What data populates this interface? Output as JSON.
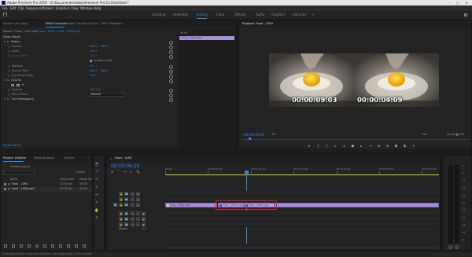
{
  "window": {
    "title": "Adobe Premiere Pro 2019 - D:\\Documents\\Adobe\\Premiere Pro\\13.0\\Untitled *",
    "controls": [
      "–",
      "□",
      "✕"
    ]
  },
  "menu": [
    "File",
    "Edit",
    "Clip",
    "Sequence",
    "Markers",
    "Graphics",
    "View",
    "Window",
    "Help"
  ],
  "workspaces": [
    "Learning",
    "Assembly",
    "Editing",
    "Color",
    "Effects",
    "Audio",
    "Graphics",
    "Libraries",
    "»"
  ],
  "active_workspace": "Editing",
  "source_panel": {
    "tabs": [
      "Source: (no clips)",
      "Effect Controls",
      "Audio Clip Mixer: Food - 1094",
      "Metadata"
    ],
    "active_tab": "Effect Controls",
    "breadcrumb": "Master * Food - 1094.mp4",
    "breadcrumb_sequence": "Food - 1094 * Food - 1094.mp4",
    "section_video": "Video Effects",
    "mini_clip": "Food - 1094.mp4",
    "mini_time": "00:00",
    "rows": [
      {
        "name": "Motion",
        "level": 1,
        "fx": true
      },
      {
        "name": "Position",
        "level": 2,
        "values": [
          "640.0",
          "360.0"
        ]
      },
      {
        "name": "Scale",
        "level": 2,
        "values": [
          "100.0"
        ]
      },
      {
        "name": "Scale Width",
        "level": 2,
        "values": [
          "100.0"
        ],
        "dim": true
      },
      {
        "name": "",
        "level": 2,
        "checkbox": "Uniform Scale"
      },
      {
        "name": "Rotation",
        "level": 2,
        "values": [
          "0.0"
        ]
      },
      {
        "name": "Anchor Point",
        "level": 2,
        "values": [
          "640.0",
          "360.0"
        ]
      },
      {
        "name": "Anti-flicker Filter",
        "level": 2,
        "values": [
          "0.00"
        ]
      },
      {
        "name": "Opacity",
        "level": 1,
        "fx": true
      },
      {
        "name": "",
        "level": 2,
        "shapes": true
      },
      {
        "name": "Opacity",
        "level": 2,
        "values": [
          "100.0 %"
        ]
      },
      {
        "name": "Blend Mode",
        "level": 2,
        "select": "Normal"
      },
      {
        "name": "Time Remapping",
        "level": 1,
        "fx": true
      }
    ],
    "timecode": "00:00:06:20"
  },
  "program_panel": {
    "title": "Program: Food - 1094",
    "timecode": "+00:00:02:09",
    "fit": "Fit",
    "quality": "Full",
    "duration": "00:00:10:00",
    "frames": [
      {
        "timecode": "00:00:09:03"
      },
      {
        "timecode": "00:00:04:09"
      }
    ],
    "transport_icons": [
      "marker",
      "in",
      "out",
      "go-in",
      "step-back",
      "play",
      "step-forward",
      "go-out",
      "insert",
      "overwrite",
      "export-frame",
      "compare",
      "add"
    ]
  },
  "project_panel": {
    "tabs": [
      "Project: Untitled",
      "Media Browser",
      "Effects",
      "»"
    ],
    "active_tab": "Project: Untitled",
    "file": "Untitled.prproj",
    "item_count": "2 Items",
    "columns": [
      "Name",
      "Frame Rate",
      "Media Sta"
    ],
    "items": [
      {
        "name": "Food - 1094",
        "rate": "25.00 fps",
        "start": "00:00",
        "color": "#46a04a"
      },
      {
        "name": "Food - 1094.mp4",
        "rate": "25.00 fps",
        "start": "00:00",
        "color": "#8f6fd0"
      }
    ]
  },
  "timeline": {
    "tab": "Food - 1094",
    "timecode": "00:00:06:20",
    "ruler": [
      "00:00",
      "00:00:05:00",
      "00:00:10:00",
      "00:00:15:00",
      "00:00:20:00",
      "00:00:25:00",
      "00:00:30:00"
    ],
    "video_tracks": [
      "V3",
      "V2",
      "V1"
    ],
    "audio_tracks": [
      "A1",
      "A2",
      "A3"
    ],
    "source_track": "V1",
    "master": "Master",
    "master_value": "0.0",
    "clips": [
      {
        "label": "Food - 1094.mp4",
        "selected": false
      },
      {
        "label": "Food - 1094.mp4",
        "selected": true
      },
      {
        "label": "Food - 1094.mp4",
        "selected": true
      },
      {
        "label": "",
        "selected": false
      }
    ],
    "tooltip": "Food - 1094.mp4   00:00:04:09 - 00:00:04:09",
    "highlight_color": "#e11b1b"
  },
  "meters": {
    "labels": [
      "0",
      "-6",
      "-12",
      "-18",
      "-24",
      "-30",
      "-36",
      "-42",
      "-48",
      "-54",
      "dB"
    ],
    "solo": [
      "S",
      "S"
    ]
  },
  "status_text": "Drag edge to trim or slip one direction, with drag rolling, Click to select"
}
